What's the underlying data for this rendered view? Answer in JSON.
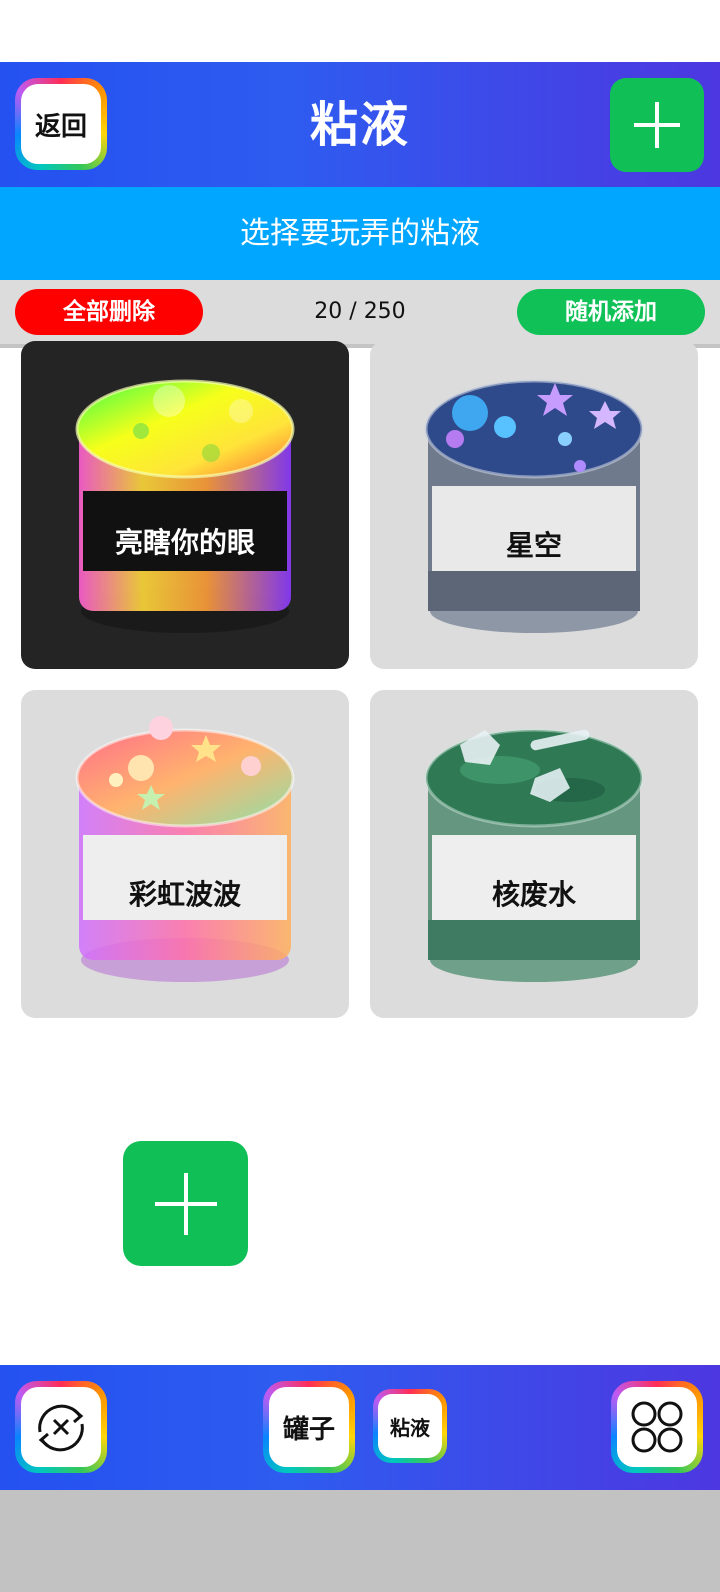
{
  "header": {
    "back_label": "返回",
    "title": "粘液",
    "add_icon": "plus-icon",
    "add_glyph": "+"
  },
  "subtitle": "选择要玩弄的粘液",
  "toolbar": {
    "delete_all_label": "全部删除",
    "counter": "20 / 250",
    "random_add_label": "随机添加"
  },
  "slimes": [
    {
      "name": "亮瞎你的眼",
      "selected": true
    },
    {
      "name": "星空",
      "selected": false
    },
    {
      "name": "彩虹波波",
      "selected": false
    },
    {
      "name": "核废水",
      "selected": false
    }
  ],
  "add_slime_glyph": "+",
  "footer": {
    "jar_label": "罐子",
    "slime_label": "粘液",
    "left_icon": "refresh-cycle-icon",
    "right_icon": "grid-circles-icon"
  },
  "colors": {
    "header_gradient": [
      "#2451f0",
      "#4d37e0"
    ],
    "subtitle": "#00a6ff",
    "delete": "#ff0000",
    "add": "#10c057"
  }
}
